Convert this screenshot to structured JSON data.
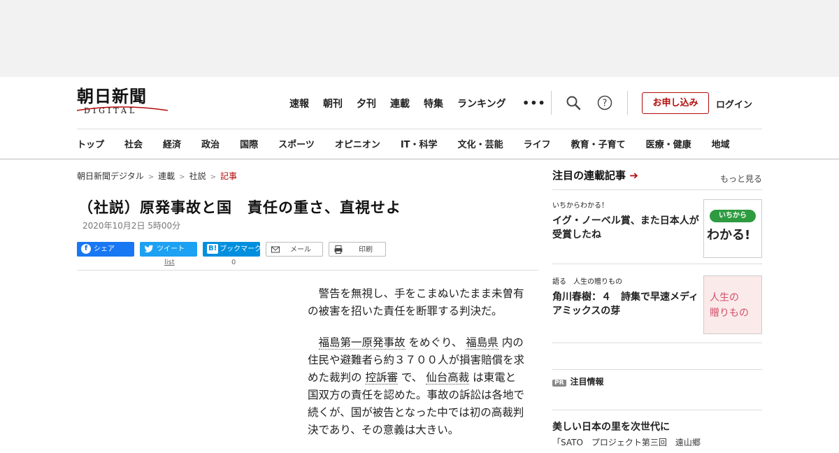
{
  "logo": {
    "main": "朝日新聞",
    "sub": "DIGITAL"
  },
  "topnav": [
    "速報",
    "朝刊",
    "夕刊",
    "連載",
    "特集",
    "ランキング"
  ],
  "more_dots": "•••",
  "subscribe_label": "お申し込み",
  "login_label": "ログイン",
  "catnav": [
    "トップ",
    "社会",
    "経済",
    "政治",
    "国際",
    "スポーツ",
    "オピニオン",
    "IT・科学",
    "文化・芸能",
    "ライフ",
    "教育・子育て",
    "医療・健康",
    "地域"
  ],
  "breadcrumb": {
    "home": "朝日新聞デジタル",
    "c1": "連載",
    "c2": "社説",
    "current": "記事",
    "sep": ">"
  },
  "article": {
    "title": "（社説）原発事故と国　責任の重さ、直視せよ",
    "date": "2020年10月2日 5時00分",
    "share": {
      "facebook": "シェア",
      "twitter": "ツイート",
      "hatena": "ブックマーク",
      "mail": "メール",
      "print": "印刷",
      "twitter_count": "list",
      "hatena_count": "0"
    },
    "p1": "警告を無視し、手をこまぬいたまま未曽有の被害を招いた責任を断罪する判決だ。",
    "p2_parts": [
      "福島第一原発事故",
      " をめぐり、 ",
      "福島県",
      " 内の住民や避難者ら約３７００人が損害賠償を求めた裁判の ",
      "控訴審",
      " で、 ",
      "仙台高裁",
      " は東電と国双方の責任を認めた。事故の訴訟は各地で続くが、国が被告となった中では初の高裁判決であり、その意義は大きい。"
    ]
  },
  "sidebar": {
    "heading": "注目の連載記事",
    "heading_arrow": "➔",
    "more_label": "もっと見る",
    "cards": [
      {
        "series": "いちからわかる！",
        "title": "イグ・ノーベル賞、また日本人が受賞したね",
        "thumb_top": "いちから",
        "thumb_main": "わかる!"
      },
      {
        "series": "語る　人生の贈りもの",
        "title": "角川春樹：４　詩集で早速メディアミックスの芽",
        "thumb_line1": "人生の",
        "thumb_line2": "贈りもの"
      }
    ],
    "pr_badge": "PR",
    "pr_label": "注目情報",
    "promo_title": "美しい日本の里を次世代に",
    "promo_sub": "「SATO　プロジェクト第三回　遠山郷"
  }
}
